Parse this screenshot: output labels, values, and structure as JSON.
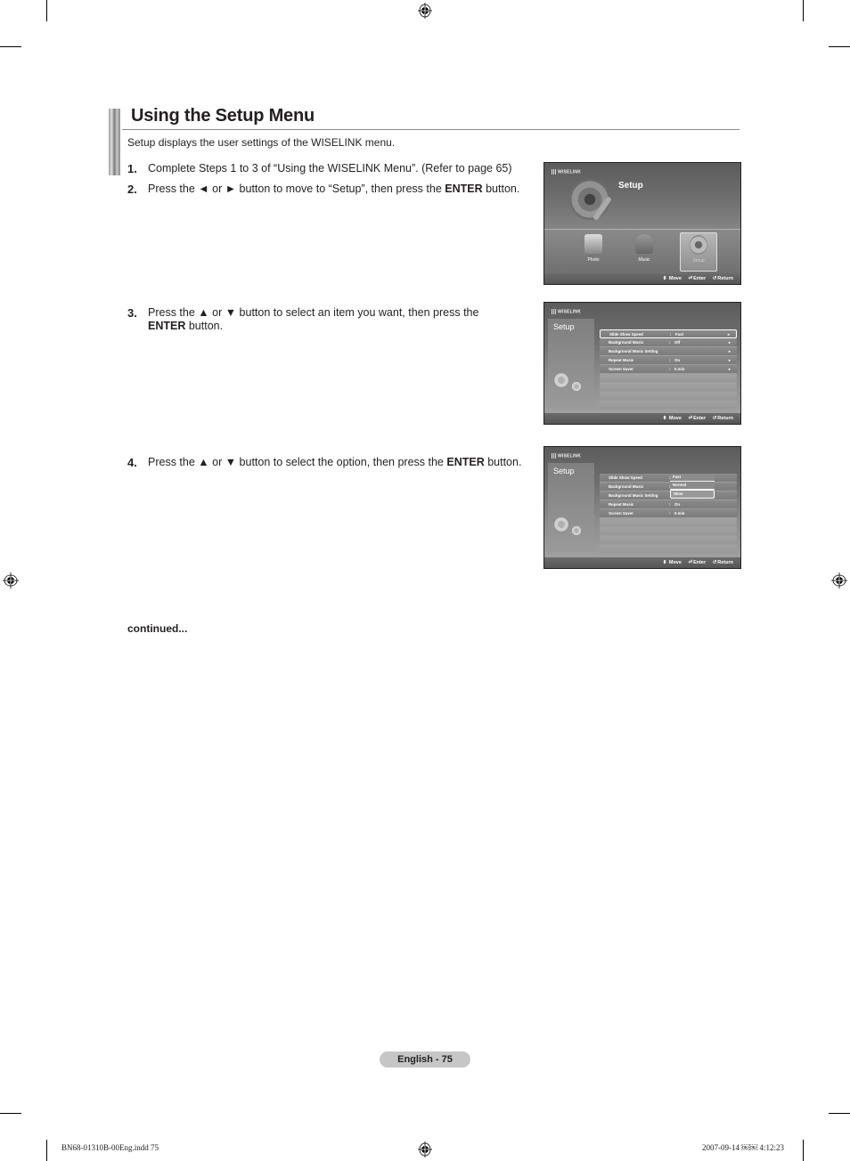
{
  "page": {
    "title": "Using the Setup Menu",
    "intro": "Setup displays the user settings of the WISELINK menu.",
    "steps": [
      {
        "num": "1.",
        "text": "Complete Steps 1 to 3 of “Using the WISELINK Menu”. (Refer to page 65)"
      },
      {
        "num": "2.",
        "pre": "Press the ◄ or ► button to move to “Setup”, then press the ",
        "bold": "ENTER",
        "post": " button."
      },
      {
        "num": "3.",
        "pre": "Press the ▲ or ▼ button to select an item you want, then press the",
        "bold": "ENTER",
        "post": " button."
      },
      {
        "num": "4.",
        "pre": "Press the ▲ or ▼ button to select the option, then press the ",
        "bold": "ENTER",
        "post": " button."
      }
    ],
    "continued": "continued...",
    "page_badge": "English - 75"
  },
  "screens": {
    "logo": "WISELINK",
    "footer": {
      "move": "Move",
      "enter": "Enter",
      "return": "Return",
      "move_icon": "updown-arrows-icon",
      "enter_icon": "enter-icon",
      "return_icon": "return-icon"
    },
    "screen1": {
      "title": "Setup",
      "apps": [
        {
          "label": "Photo",
          "icon": "photo-icon"
        },
        {
          "label": "Music",
          "icon": "headphones-icon"
        },
        {
          "label": "Setup",
          "icon": "gear-icon",
          "selected": true
        }
      ]
    },
    "screen2": {
      "side_title": "Setup",
      "rows": [
        {
          "label": "Slide Show Speed",
          "value": "Fast",
          "arrow": "►",
          "highlighted": true
        },
        {
          "label": "Background Music",
          "value": "Off",
          "arrow": "►"
        },
        {
          "label": "Background Music Setting",
          "value": "",
          "arrow": "►"
        },
        {
          "label": "Repeat Music",
          "value": "On",
          "arrow": "►"
        },
        {
          "label": "Screen Saver",
          "value": "5 min",
          "arrow": "►"
        }
      ]
    },
    "screen3": {
      "side_title": "Setup",
      "rows": [
        {
          "label": "Slide Show Speed"
        },
        {
          "label": "Background Music"
        },
        {
          "label": "Background Music Setting"
        },
        {
          "label": "Repeat Music",
          "value": "On"
        },
        {
          "label": "Screen Saver",
          "value": "5 min"
        }
      ],
      "options": [
        "Fast",
        "Normal",
        "Slow"
      ],
      "selected_option": "Slow"
    }
  },
  "slug": {
    "left": "BN68-01310B-00Eng.indd   75",
    "right": "2007-09-14   ￼￼ 4:12:23"
  }
}
